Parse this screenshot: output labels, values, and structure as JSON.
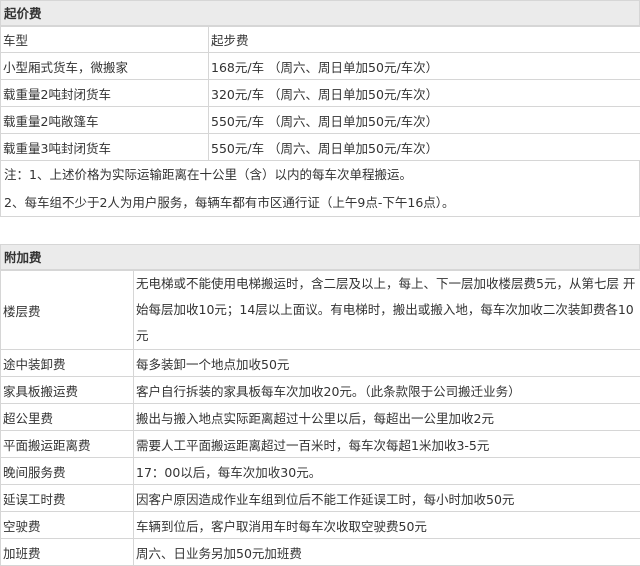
{
  "section1": {
    "title": "起价费",
    "headers": [
      "车型",
      "起步费"
    ],
    "rows": [
      {
        "type": "小型厢式货车，微搬家",
        "fee": "168元/车 （周六、周日单加50元/车次）"
      },
      {
        "type": "载重量2吨封闭货车",
        "fee": "320元/车 （周六、周日单加50元/车次）"
      },
      {
        "type": "载重量2吨敞篷车",
        "fee": "550元/车 （周六、周日单加50元/车次）"
      },
      {
        "type": "载重量3吨封闭货车",
        "fee": "550元/车 （周六、周日单加50元/车次）"
      }
    ],
    "notes": [
      "注：1、上述价格为实际运输距离在十公里（含）以内的每车次单程搬运。",
      "2、每车组不少于2人为用户服务，每辆车都有市区通行证（上午9点-下午16点）。"
    ]
  },
  "section2": {
    "title": "附加费",
    "rows": [
      {
        "name": "楼层费",
        "desc": "无电梯或不能使用电梯搬运时，含二层及以上，每上、下一层加收楼层费5元，从第七层 开始每层加收10元；14层以上面议。有电梯时，搬出或搬入地，每车次加收二次装卸费各10元"
      },
      {
        "name": "途中装卸费",
        "desc": "每多装卸一个地点加收50元"
      },
      {
        "name": "家具板搬运费",
        "desc": "客户自行拆装的家具板每车次加收20元。（此条款限于公司搬迁业务）"
      },
      {
        "name": "超公里费",
        "desc": "搬出与搬入地点实际距离超过十公里以后，每超出一公里加收2元"
      },
      {
        "name": "平面搬运距离费",
        "desc": "需要人工平面搬运距离超过一百米时，每车次每超1米加收3-5元"
      },
      {
        "name": "晚间服务费",
        "desc": "17：00以后，每车次加收30元。"
      },
      {
        "name": "延误工时费",
        "desc": "因客户原因造成作业车组到位后不能工作延误工时，每小时加收50元"
      },
      {
        "name": "空驶费",
        "desc": "车辆到位后，客户取消用车时每车次收取空驶费50元"
      },
      {
        "name": "加班费",
        "desc": "周六、日业务另加50元加班费"
      }
    ]
  }
}
